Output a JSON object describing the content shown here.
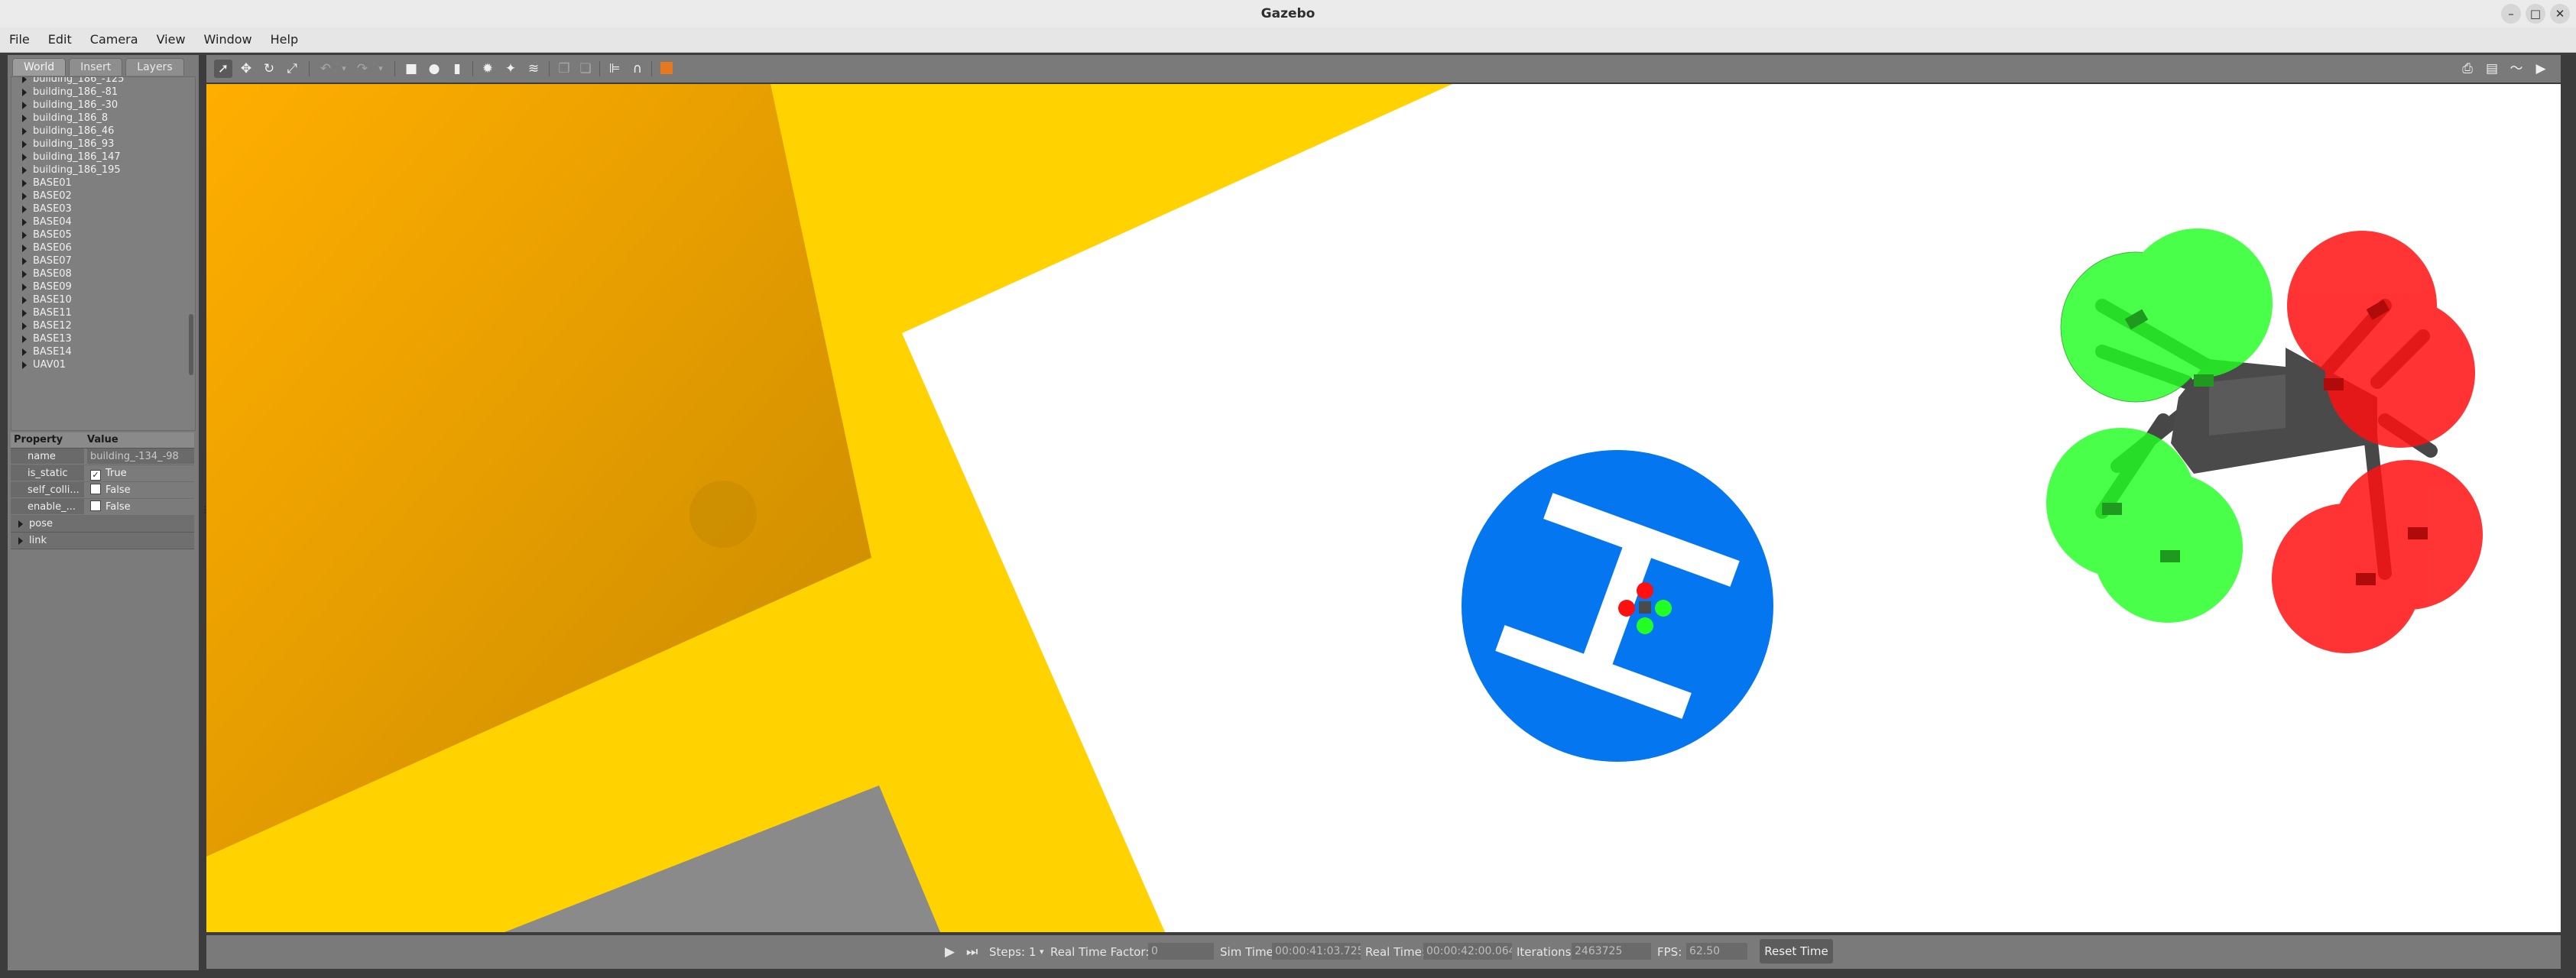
{
  "window": {
    "title": "Gazebo"
  },
  "menu": [
    "File",
    "Edit",
    "Camera",
    "View",
    "Window",
    "Help"
  ],
  "left_panel": {
    "tabs": [
      "World",
      "Insert",
      "Layers"
    ],
    "active_tab": "World",
    "tree_items": [
      "building_186_-125",
      "building_186_-81",
      "building_186_-30",
      "building_186_8",
      "building_186_46",
      "building_186_93",
      "building_186_147",
      "building_186_195",
      "BASE01",
      "BASE02",
      "BASE03",
      "BASE04",
      "BASE05",
      "BASE06",
      "BASE07",
      "BASE08",
      "BASE09",
      "BASE10",
      "BASE11",
      "BASE12",
      "BASE13",
      "BASE14",
      "UAV01"
    ],
    "properties": {
      "header_property": "Property",
      "header_value": "Value",
      "rows": [
        {
          "key": "name",
          "value": "building_-134_-98",
          "checkbox": false
        },
        {
          "key": "is_static",
          "value": "True",
          "checkbox": true,
          "checked": true
        },
        {
          "key": "self_colli...",
          "value": "False",
          "checkbox": true,
          "checked": false
        },
        {
          "key": "enable_...",
          "value": "False",
          "checkbox": true,
          "checked": false
        }
      ],
      "expandables": [
        "pose",
        "link"
      ]
    }
  },
  "toolbar": {
    "icons": [
      "select-arrow-icon",
      "translate-icon",
      "rotate-icon",
      "scale-icon",
      "undo-icon",
      "undo-menu-icon",
      "redo-icon",
      "redo-menu-icon",
      "box-icon",
      "sphere-icon",
      "cylinder-icon",
      "point-light-icon",
      "spot-light-icon",
      "directional-light-icon",
      "copy-icon",
      "paste-icon",
      "align-icon",
      "snap-icon",
      "color-swatch-icon"
    ],
    "right_icons": [
      "screenshot-icon",
      "log-icon",
      "plot-icon",
      "video-record-icon"
    ]
  },
  "viewport": {
    "colors": {
      "ground": "#ffffff",
      "yellow": "#ffd200",
      "orange_roof": "#f5a300",
      "gray": "#8a8a8a",
      "helipad_blue": "#0477f0",
      "prop_green": "#22ff22",
      "prop_red": "#ff1010",
      "drone_body": "#4a4a4a"
    },
    "helipad_letter": "H"
  },
  "bottom_bar": {
    "steps_label": "Steps:",
    "steps_value": "1",
    "rtf_label": "Real Time Factor:",
    "rtf_value": "0",
    "sim_time_label": "Sim Time",
    "sim_time_value": "00:00:41:03.725",
    "real_time_label": "Real Time:",
    "real_time_value": "00:00:42:00.064",
    "iterations_label": "Iterations:",
    "iterations_value": "2463725",
    "fps_label": "FPS:",
    "fps_value": "62.50",
    "reset_label": "Reset Time"
  }
}
